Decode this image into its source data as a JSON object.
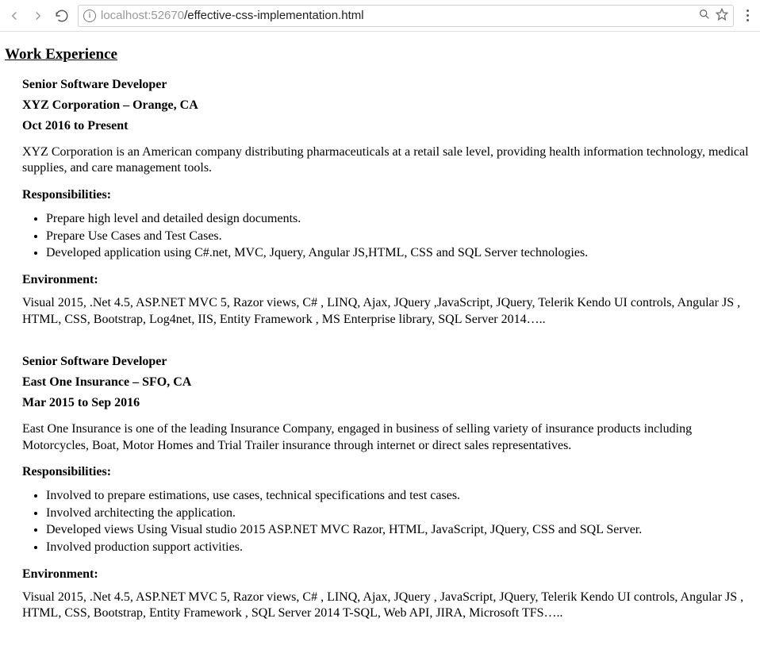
{
  "browser": {
    "url_host": "localhost",
    "url_port": ":52670",
    "url_path": "/effective-css-implementation.html"
  },
  "section_title": "Work Experience",
  "labels": {
    "responsibilities": "Responsibilities:",
    "environment": "Environment:"
  },
  "jobs": [
    {
      "title": "Senior Software Developer",
      "company": "XYZ Corporation – Orange, CA",
      "dates": "Oct 2016 to Present",
      "desc": "XYZ Corporation is an American company distributing pharmaceuticals at a retail sale level, providing health information technology, medical supplies, and care management tools.",
      "responsibilities": [
        "Prepare high level and detailed design documents.",
        "Prepare Use Cases and Test Cases.",
        "Developed application using C#.net, MVC, Jquery, Angular JS,HTML, CSS and SQL Server technologies."
      ],
      "environment": "Visual 2015, .Net 4.5, ASP.NET MVC 5, Razor views, C# , LINQ, Ajax, JQuery ,JavaScript, JQuery, Telerik Kendo UI controls, Angular JS , HTML, CSS, Bootstrap, Log4net, IIS, Entity Framework , MS Enterprise library, SQL Server 2014….."
    },
    {
      "title": "Senior Software Developer",
      "company": "East One Insurance – SFO, CA",
      "dates": "Mar 2015 to Sep 2016",
      "desc": "East One Insurance is one of the leading Insurance Company, engaged in business of selling variety of insurance products including Motorcycles, Boat, Motor Homes and Trial Trailer insurance through internet or direct sales representatives.",
      "responsibilities": [
        "Involved to prepare estimations, use cases, technical specifications and test cases.",
        "Involved architecting the application.",
        "Developed views Using Visual studio 2015 ASP.NET MVC Razor, HTML, JavaScript, JQuery, CSS and SQL Server.",
        "Involved production support activities."
      ],
      "environment": "Visual 2015, .Net 4.5, ASP.NET MVC 5, Razor views, C# , LINQ, Ajax, JQuery , JavaScript, JQuery, Telerik Kendo UI controls, Angular JS , HTML, CSS, Bootstrap, Entity Framework , SQL Server 2014 T-SQL, Web API, JIRA, Microsoft TFS….."
    }
  ]
}
